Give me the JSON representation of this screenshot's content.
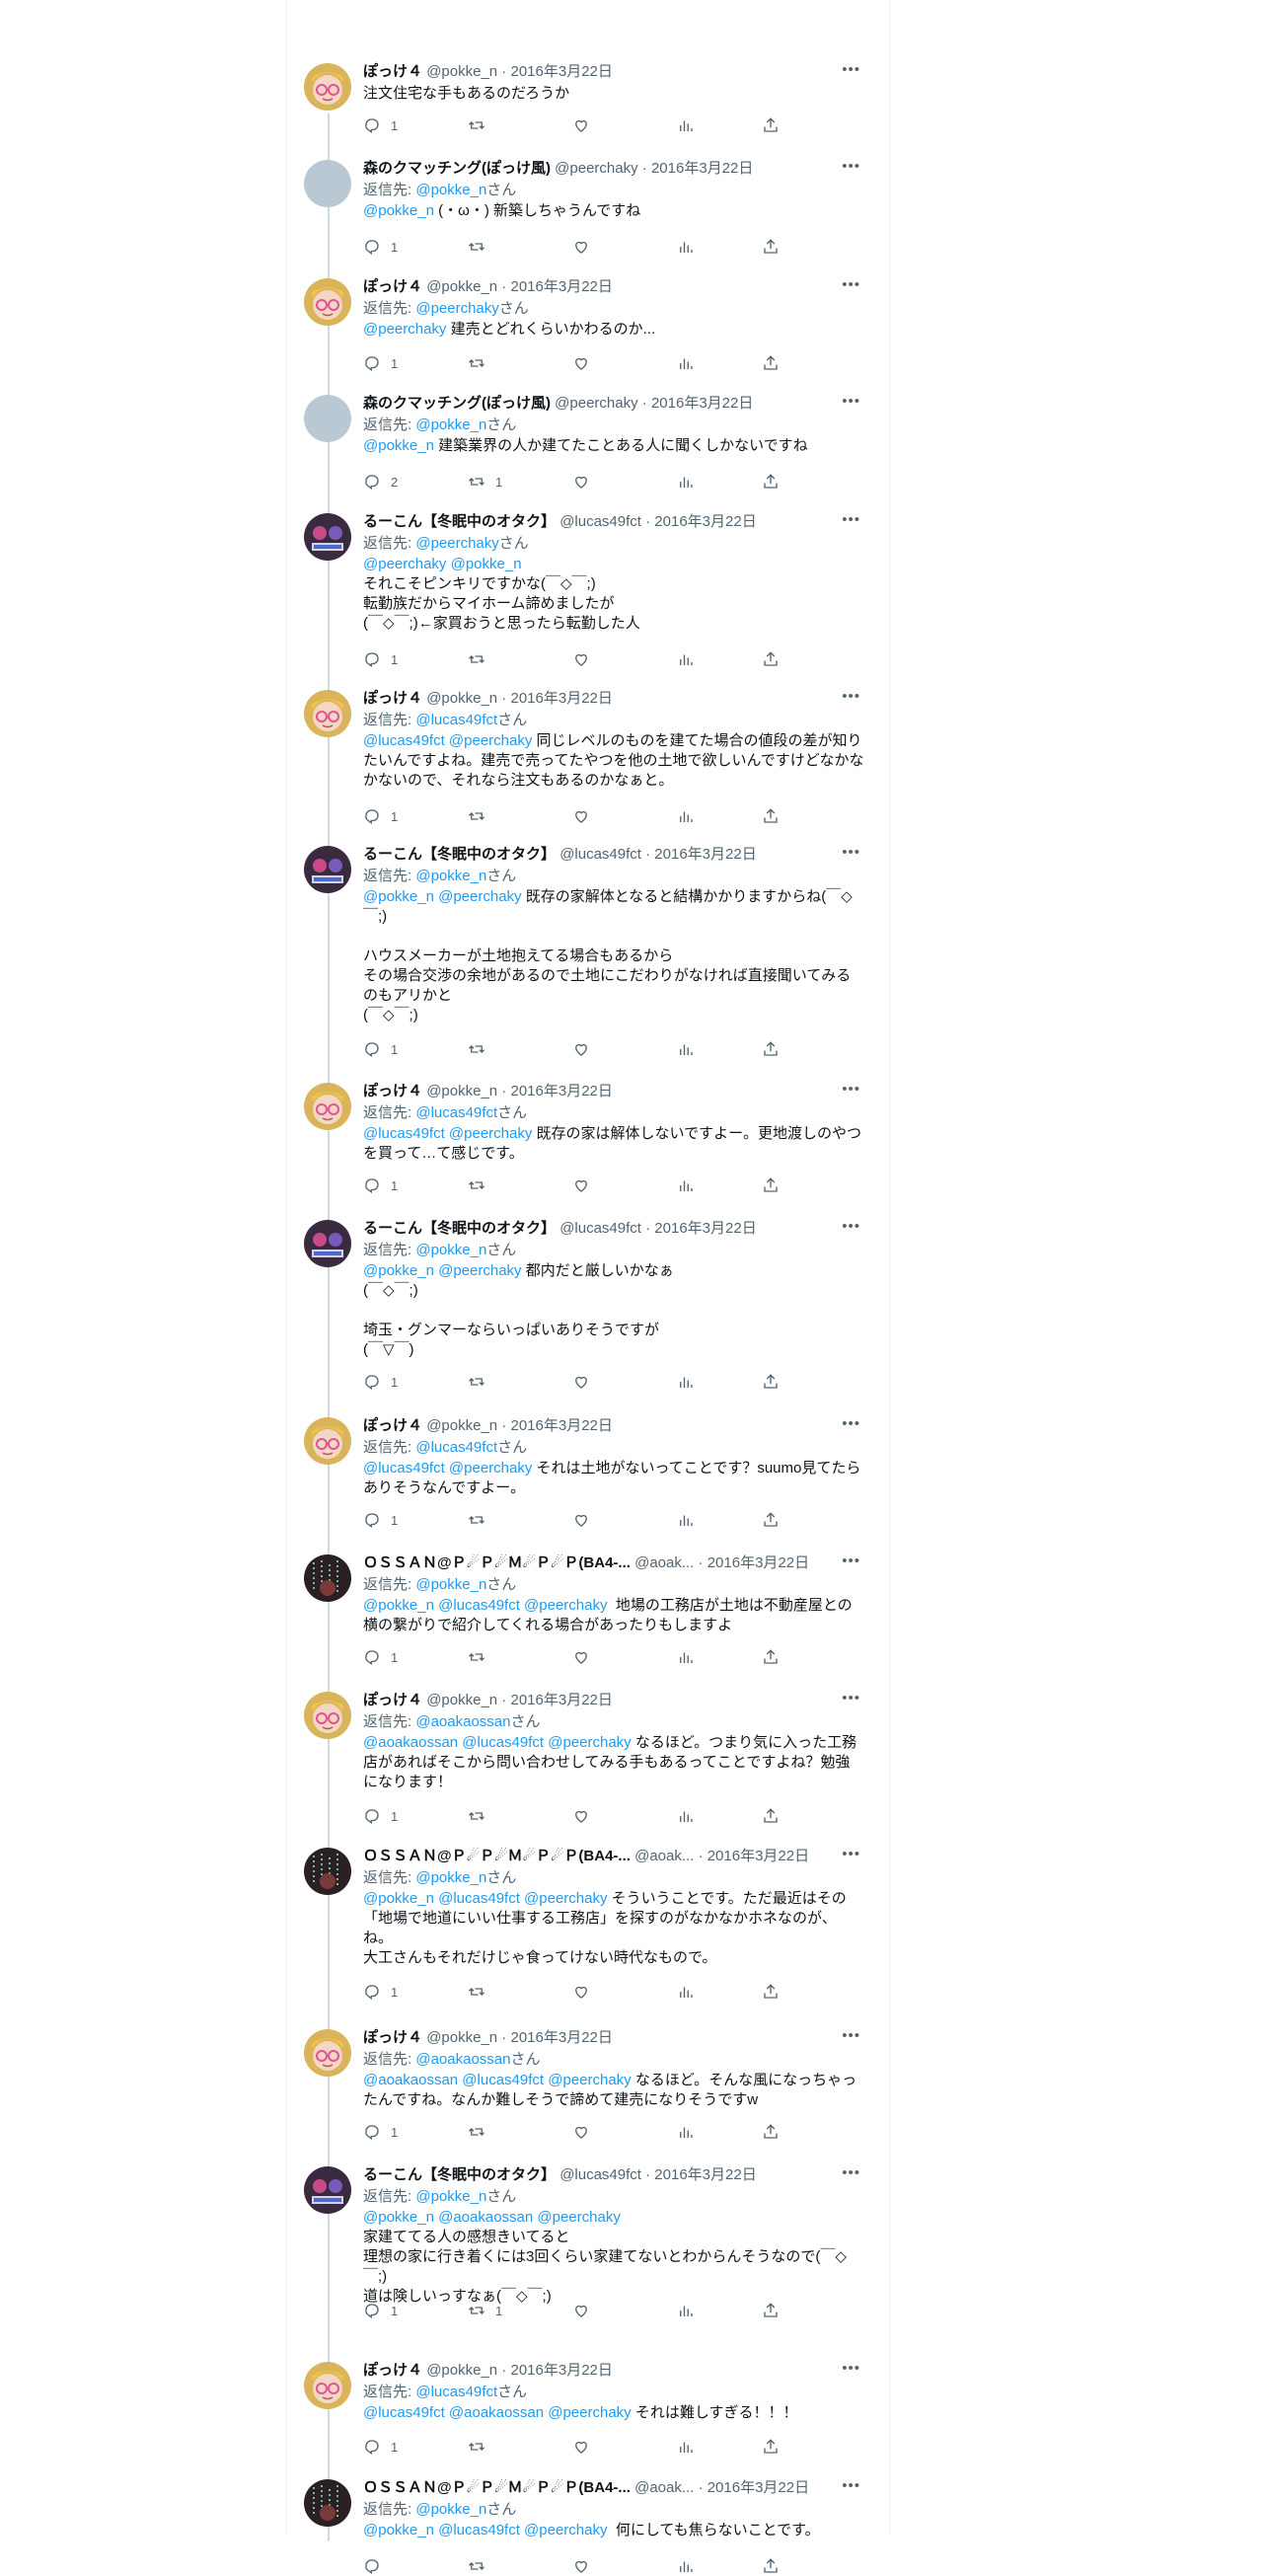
{
  "colors": {
    "link": "#1d9bf0",
    "muted": "#536471",
    "text": "#0f1419",
    "thread": "#cfd9de"
  },
  "icons": {
    "reply": "reply-icon",
    "retweet": "retweet-icon",
    "like": "heart-icon",
    "views": "views-icon",
    "share": "share-icon",
    "more": "more-icon"
  },
  "tweets": [
    {
      "name": "ぽっけ４",
      "handle": "@pokke_n",
      "date": "2016年3月22日",
      "reply_prefix": "",
      "reply_user": "",
      "reply_suffix": "",
      "mentions": "",
      "text": "注文住宅な手もあるのだろうか",
      "replies": "1",
      "retweets": "",
      "likes": ""
    },
    {
      "name": "森のクマッチング(ぽっけ風)",
      "handle": "@peerchaky",
      "date": "2016年3月22日",
      "reply_prefix": "返信先: ",
      "reply_user": "@pokke_n",
      "reply_suffix": "さん",
      "mentions": "@pokke_n",
      "text": " (・ω・) 新築しちゃうんですね",
      "replies": "1",
      "retweets": "",
      "likes": ""
    },
    {
      "name": "ぽっけ４",
      "handle": "@pokke_n",
      "date": "2016年3月22日",
      "reply_prefix": "返信先: ",
      "reply_user": "@peerchaky",
      "reply_suffix": "さん",
      "mentions": "@peerchaky",
      "text": " 建売とどれくらいかわるのか...",
      "replies": "1",
      "retweets": "",
      "likes": ""
    },
    {
      "name": "森のクマッチング(ぽっけ風)",
      "handle": "@peerchaky",
      "date": "2016年3月22日",
      "reply_prefix": "返信先: ",
      "reply_user": "@pokke_n",
      "reply_suffix": "さん",
      "mentions": "@pokke_n",
      "text": " 建築業界の人か建てたことある人に聞くしかないですね",
      "replies": "2",
      "retweets": "1",
      "likes": ""
    },
    {
      "name": "るーこん【冬眠中のオタク】",
      "handle": "@lucas49fct",
      "date": "2016年3月22日",
      "reply_prefix": "返信先: ",
      "reply_user": "@peerchaky",
      "reply_suffix": "さん",
      "mentions": "@peerchaky @pokke_n",
      "text": "\nそれこそピンキリですかな(￣◇￣;)\n転勤族だからマイホーム諦めましたが\n(￣◇￣;)←家買おうと思ったら転勤した人",
      "replies": "1",
      "retweets": "",
      "likes": ""
    },
    {
      "name": "ぽっけ４",
      "handle": "@pokke_n",
      "date": "2016年3月22日",
      "reply_prefix": "返信先: ",
      "reply_user": "@lucas49fct",
      "reply_suffix": "さん",
      "mentions": "@lucas49fct @peerchaky",
      "text": " 同じレベルのものを建てた場合の値段の差が知りたいんですよね。建売で売ってたやつを他の土地で欲しいんですけどなかなかないので、それなら注文もあるのかなぁと。",
      "replies": "1",
      "retweets": "",
      "likes": ""
    },
    {
      "name": "るーこん【冬眠中のオタク】",
      "handle": "@lucas49fct",
      "date": "2016年3月22日",
      "reply_prefix": "返信先: ",
      "reply_user": "@pokke_n",
      "reply_suffix": "さん",
      "mentions": "@pokke_n @peerchaky",
      "text": " 既存の家解体となると結構かかりますからね(￣◇￣;)\n\nハウスメーカーが土地抱えてる場合もあるから\nその場合交渉の余地があるので土地にこだわりがなければ直接聞いてみるのもアリかと\n(￣◇￣;)",
      "replies": "1",
      "retweets": "",
      "likes": ""
    },
    {
      "name": "ぽっけ４",
      "handle": "@pokke_n",
      "date": "2016年3月22日",
      "reply_prefix": "返信先: ",
      "reply_user": "@lucas49fct",
      "reply_suffix": "さん",
      "mentions": "@lucas49fct @peerchaky",
      "text": " 既存の家は解体しないですよー。更地渡しのやつを買って…て感じです。",
      "replies": "1",
      "retweets": "",
      "likes": ""
    },
    {
      "name": "るーこん【冬眠中のオタク】",
      "handle": "@lucas49fct",
      "date": "2016年3月22日",
      "reply_prefix": "返信先: ",
      "reply_user": "@pokke_n",
      "reply_suffix": "さん",
      "mentions": "@pokke_n @peerchaky",
      "text": " 都内だと厳しいかなぁ\n(￣◇￣;)\n\n埼玉・グンマーならいっぱいありそうですが\n(￣▽￣)",
      "replies": "1",
      "retweets": "",
      "likes": ""
    },
    {
      "name": "ぽっけ４",
      "handle": "@pokke_n",
      "date": "2016年3月22日",
      "reply_prefix": "返信先: ",
      "reply_user": "@lucas49fct",
      "reply_suffix": "さん",
      "mentions": "@lucas49fct @peerchaky",
      "text": " それは土地がないってことです？suumo見てたらありそうなんですよー。",
      "replies": "1",
      "retweets": "",
      "likes": ""
    },
    {
      "name": "ＯＳＳＡＮ@Ｐ☄Ｐ☄Ｍ☄Ｐ☄Ｐ(BA4-...",
      "handle": "@aoak...",
      "date": "2016年3月22日",
      "reply_prefix": "返信先: ",
      "reply_user": "@pokke_n",
      "reply_suffix": "さん",
      "mentions": "@pokke_n @lucas49fct @peerchaky",
      "text": "  地場の工務店が土地は不動産屋との横の繋がりで紹介してくれる場合があったりもしますよ",
      "replies": "1",
      "retweets": "",
      "likes": ""
    },
    {
      "name": "ぽっけ４",
      "handle": "@pokke_n",
      "date": "2016年3月22日",
      "reply_prefix": "返信先: ",
      "reply_user": "@aoakaossan",
      "reply_suffix": "さん",
      "mentions": "@aoakaossan @lucas49fct @peerchaky",
      "text": " なるほど。つまり気に入った工務店があればそこから問い合わせしてみる手もあるってことですよね？勉強になります！",
      "replies": "1",
      "retweets": "",
      "likes": ""
    },
    {
      "name": "ＯＳＳＡＮ@Ｐ☄Ｐ☄Ｍ☄Ｐ☄Ｐ(BA4-...",
      "handle": "@aoak...",
      "date": "2016年3月22日",
      "reply_prefix": "返信先: ",
      "reply_user": "@pokke_n",
      "reply_suffix": "さん",
      "mentions": "@pokke_n @lucas49fct @peerchaky",
      "text": " そういうことです。ただ最近はその「地場で地道にいい仕事する工務店」を探すのがなかなかホネなのが、ね。\n大工さんもそれだけじゃ食ってけない時代なもので。",
      "replies": "1",
      "retweets": "",
      "likes": ""
    },
    {
      "name": "ぽっけ４",
      "handle": "@pokke_n",
      "date": "2016年3月22日",
      "reply_prefix": "返信先: ",
      "reply_user": "@aoakaossan",
      "reply_suffix": "さん",
      "mentions": "@aoakaossan @lucas49fct @peerchaky",
      "text": " なるほど。そんな風になっちゃったんですね。なんか難しそうで諦めて建売になりそうですw",
      "replies": "1",
      "retweets": "",
      "likes": ""
    },
    {
      "name": "るーこん【冬眠中のオタク】",
      "handle": "@lucas49fct",
      "date": "2016年3月22日",
      "reply_prefix": "返信先: ",
      "reply_user": "@pokke_n",
      "reply_suffix": "さん",
      "mentions": "@pokke_n @aoakaossan @peerchaky",
      "text": "\n家建ててる人の感想きいてると\n理想の家に行き着くには3回くらい家建てないとわからんそうなので(￣◇￣;)\n道は険しいっすなぁ(￣◇￣;)",
      "replies": "1",
      "retweets": "1",
      "likes": ""
    },
    {
      "name": "ぽっけ４",
      "handle": "@pokke_n",
      "date": "2016年3月22日",
      "reply_prefix": "返信先: ",
      "reply_user": "@lucas49fct",
      "reply_suffix": "さん",
      "mentions": "@lucas49fct @aoakaossan @peerchaky",
      "text": " それは難しすぎる！！！",
      "replies": "1",
      "retweets": "",
      "likes": ""
    },
    {
      "name": "ＯＳＳＡＮ@Ｐ☄Ｐ☄Ｍ☄Ｐ☄Ｐ(BA4-...",
      "handle": "@aoak...",
      "date": "2016年3月22日",
      "reply_prefix": "返信先: ",
      "reply_user": "@pokke_n",
      "reply_suffix": "さん",
      "mentions": "@pokke_n @lucas49fct @peerchaky",
      "text": "  何にしても焦らないことです。",
      "replies": "",
      "retweets": "",
      "likes": ""
    }
  ]
}
